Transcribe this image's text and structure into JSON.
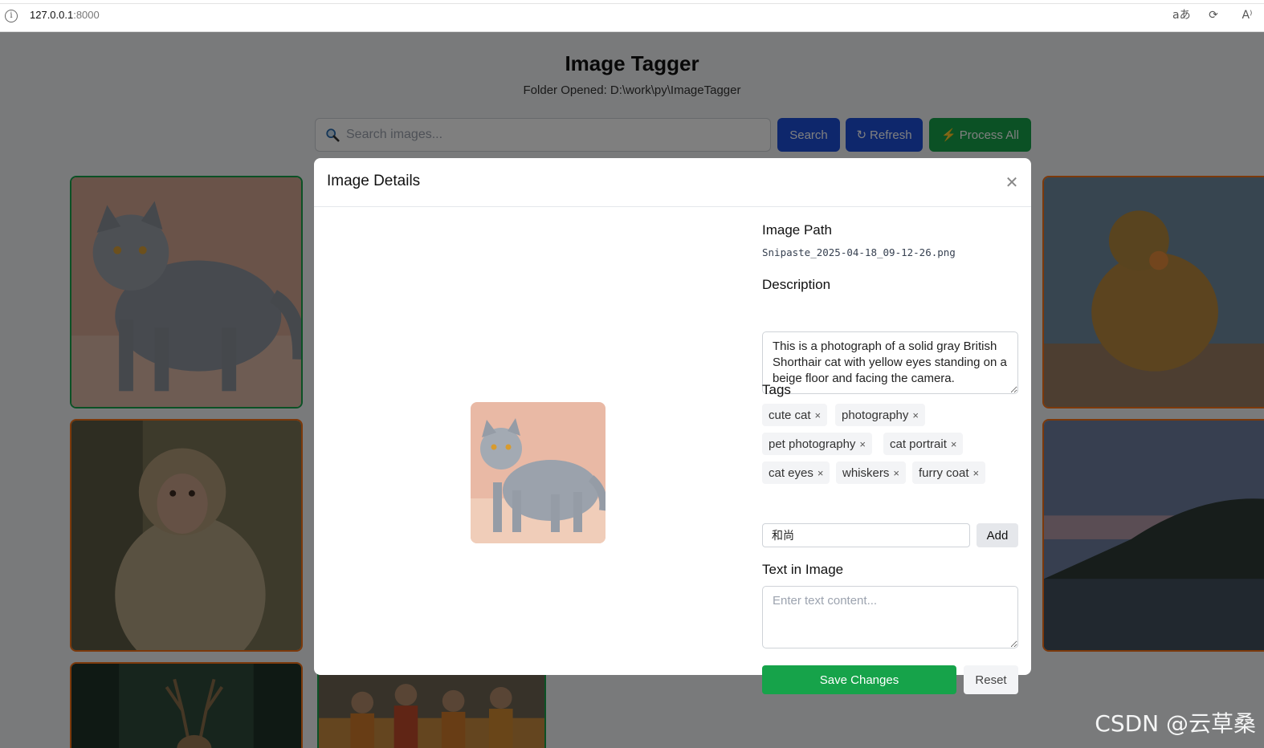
{
  "browser": {
    "url_host": "127.0.0.1",
    "url_port": ":8000"
  },
  "app": {
    "title": "Image Tagger",
    "folder_line": "Folder Opened: D:\\work\\py\\ImageTagger",
    "search_placeholder": "Search images...",
    "search_button": "Search",
    "refresh_button": "Refresh",
    "process_all_button": "Process All"
  },
  "modal": {
    "title": "Image Details",
    "image_path_label": "Image Path",
    "image_path_value": "Snipaste_2025-04-18_09-12-26.png",
    "description_label": "Description",
    "description_value": "This is a photograph of a solid gray British Shorthair cat with yellow eyes standing on a beige floor and facing the camera.",
    "tags_label": "Tags",
    "tags": [
      "cute cat",
      "photography",
      "pet photography",
      "cat portrait",
      "cat eyes",
      "whiskers",
      "furry coat"
    ],
    "tag_remove_glyph": "×",
    "new_tag_value": "和尚",
    "add_button": "Add",
    "text_in_image_label": "Text in Image",
    "text_in_image_placeholder": "Enter text content...",
    "save_button": "Save Changes",
    "reset_button": "Reset"
  },
  "watermark": "CSDN @云草桑",
  "colors": {
    "primary": "#1d4ed8",
    "success": "#16a34a",
    "card_border_orange": "#f97316"
  }
}
